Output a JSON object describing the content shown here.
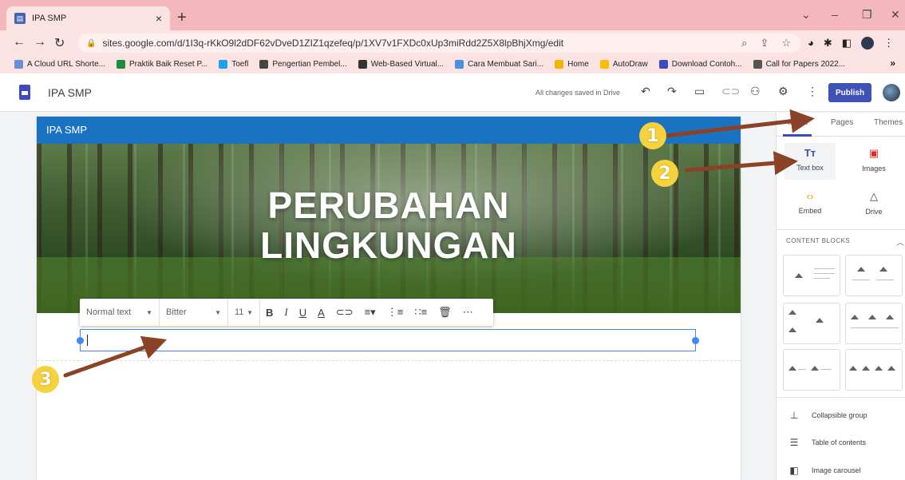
{
  "browser": {
    "tab_title": "IPA SMP",
    "tab_close": "×",
    "new_tab": "+",
    "url": "sites.google.com/d/1I3q-rKkO9l2dDF62vDveD1ZIZ1qzefeq/p/1XV7v1FXDc0xUp3miRdd2Z5X8lpBhjXmg/edit",
    "bookmarks": [
      {
        "label": "A Cloud URL Shorte...",
        "color": "#6b8fd4"
      },
      {
        "label": "Praktik Baik Reset P...",
        "color": "#1e8e3e"
      },
      {
        "label": "Toefl",
        "color": "#1da1f2"
      },
      {
        "label": "Pengertian Pembel...",
        "color": "#444444"
      },
      {
        "label": "Web-Based Virtual...",
        "color": "#333333"
      },
      {
        "label": "Cara Membuat Sari...",
        "color": "#4a90e2"
      },
      {
        "label": "Home",
        "color": "#f4b400"
      },
      {
        "label": "AutoDraw",
        "color": "#fbbc04"
      },
      {
        "label": "Download Contoh...",
        "color": "#3c4cc0"
      },
      {
        "label": "Call for Papers 2022...",
        "color": "#555555"
      }
    ],
    "bookmarks_more": "»"
  },
  "header": {
    "site_name": "IPA SMP",
    "saved_status": "All changes saved in Drive",
    "publish_label": "Publish"
  },
  "page": {
    "site_bar_title": "IPA SMP",
    "hero_line1": "PERUBAHAN",
    "hero_line2": "LINGKUNGAN"
  },
  "toolbar": {
    "style": "Normal text",
    "font": "Bitter",
    "size": "11"
  },
  "panel": {
    "tabs": [
      "Insert",
      "Pages",
      "Themes"
    ],
    "insert_items": [
      "Text box",
      "Images",
      "Embed",
      "Drive"
    ],
    "content_blocks_header": "CONTENT BLOCKS",
    "list_items": [
      "Collapsible group",
      "Table of contents",
      "Image carousel"
    ]
  },
  "annotations": [
    "1",
    "2",
    "3"
  ],
  "colors": {
    "accent": "#3f51b5",
    "site_bar": "#1a73c0",
    "arrow": "#8b4226",
    "badge": "#f5d23e",
    "chrome_pink": "#f4b8bc"
  }
}
